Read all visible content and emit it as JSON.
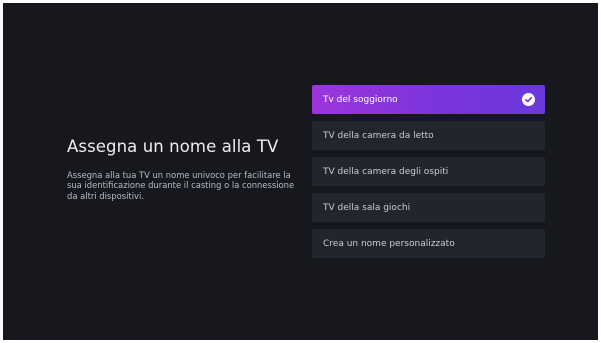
{
  "page": {
    "title": "Assegna un nome alla TV",
    "description": "Assegna alla tua TV un nome univoco per facilitare la sua identificazione durante il casting o la connessione da altri dispositivi."
  },
  "options": [
    {
      "label": "Tv del soggiorno",
      "selected": true
    },
    {
      "label": "TV della camera da letto",
      "selected": false
    },
    {
      "label": "TV della camera degli ospiti",
      "selected": false
    },
    {
      "label": "TV della sala giochi",
      "selected": false
    },
    {
      "label": "Crea un nome personalizzato",
      "selected": false
    }
  ],
  "colors": {
    "background": "#17181e",
    "option_background": "#23252d",
    "accent_start": "#9c36dc",
    "accent_end": "#6a38d8"
  },
  "icons": {
    "selected_indicator": "checkmark-circle-icon"
  }
}
